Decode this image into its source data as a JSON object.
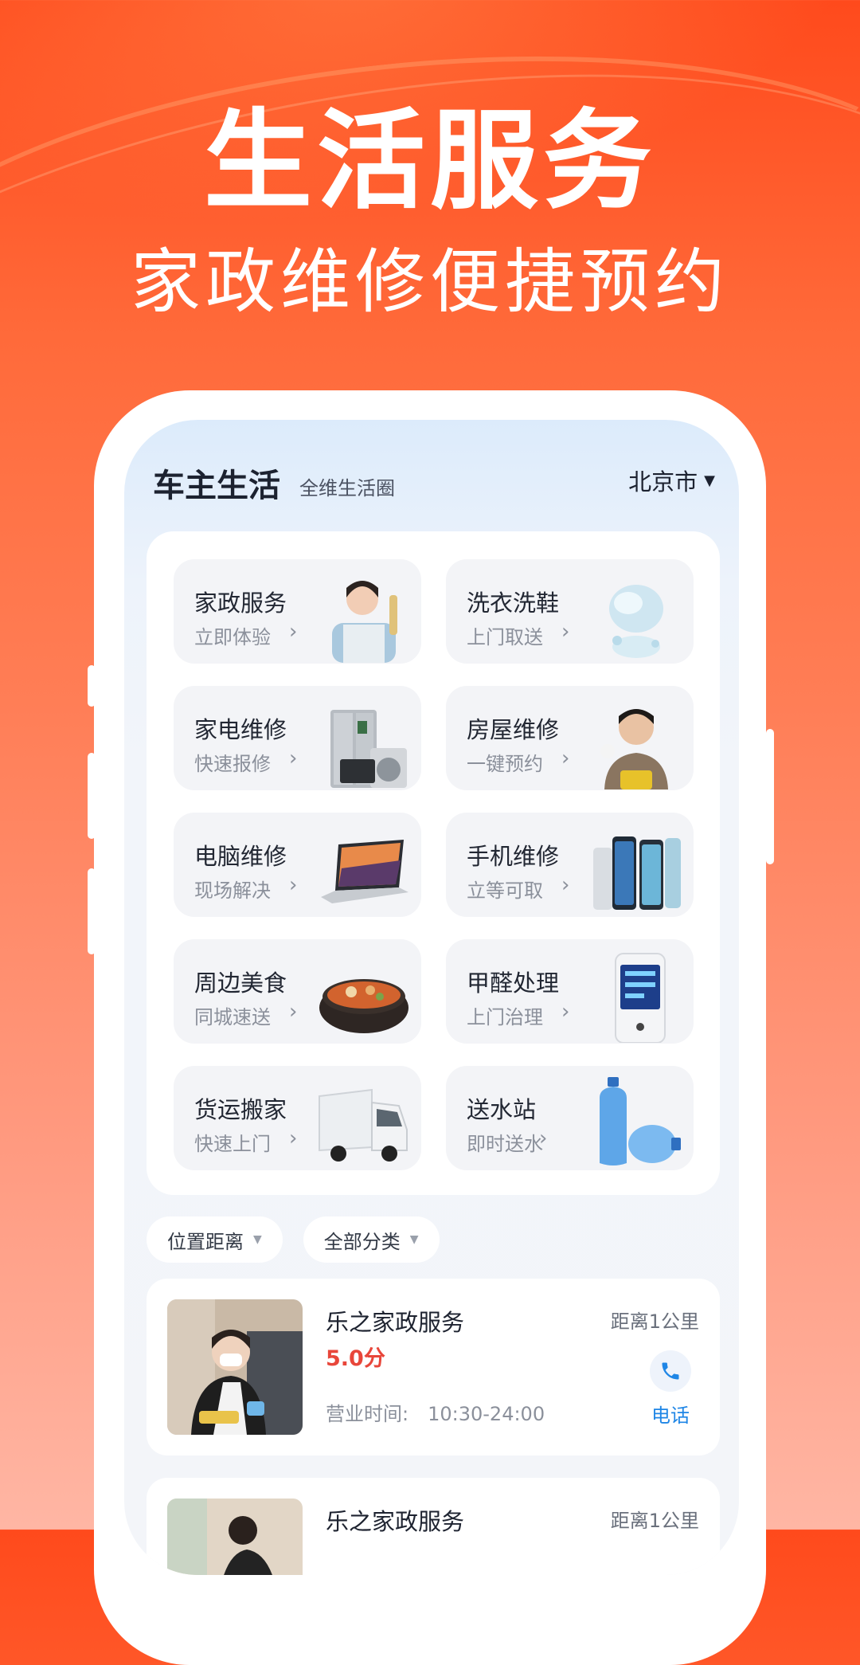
{
  "hero": {
    "title": "生活服务",
    "subtitle": "家政维修便捷预约"
  },
  "app": {
    "title": "车主生活",
    "subtitle": "全维生活圈",
    "city": "北京市"
  },
  "services": [
    {
      "title": "家政服务",
      "sub": "立即体验",
      "icon": "housekeeper-icon"
    },
    {
      "title": "洗衣洗鞋",
      "sub": "上门取送",
      "icon": "laundry-icon"
    },
    {
      "title": "家电维修",
      "sub": "快速报修",
      "icon": "appliance-icon"
    },
    {
      "title": "房屋维修",
      "sub": "一键预约",
      "icon": "repairman-icon"
    },
    {
      "title": "电脑维修",
      "sub": "现场解决",
      "icon": "laptop-icon"
    },
    {
      "title": "手机维修",
      "sub": "立等可取",
      "icon": "phone-icon"
    },
    {
      "title": "周边美食",
      "sub": "同城速送",
      "icon": "food-icon"
    },
    {
      "title": "甲醛处理",
      "sub": "上门治理",
      "icon": "formaldehyde-meter-icon"
    },
    {
      "title": "货运搬家",
      "sub": "快速上门",
      "icon": "truck-icon"
    },
    {
      "title": "送水站",
      "sub": "即时送水",
      "icon": "water-bottle-icon"
    }
  ],
  "filters": {
    "distance": "位置距离",
    "category": "全部分类"
  },
  "shops": [
    {
      "name": "乐之家政服务",
      "score": "5.0分",
      "distance": "距离1公里",
      "hours_label": "营业时间:",
      "hours": "10:30-24:00",
      "call": "电话"
    },
    {
      "name": "乐之家政服务",
      "distance": "距离1公里"
    }
  ],
  "colors": {
    "accent": "#ff4a1c",
    "score": "#e8463a",
    "call": "#1f86e6"
  }
}
